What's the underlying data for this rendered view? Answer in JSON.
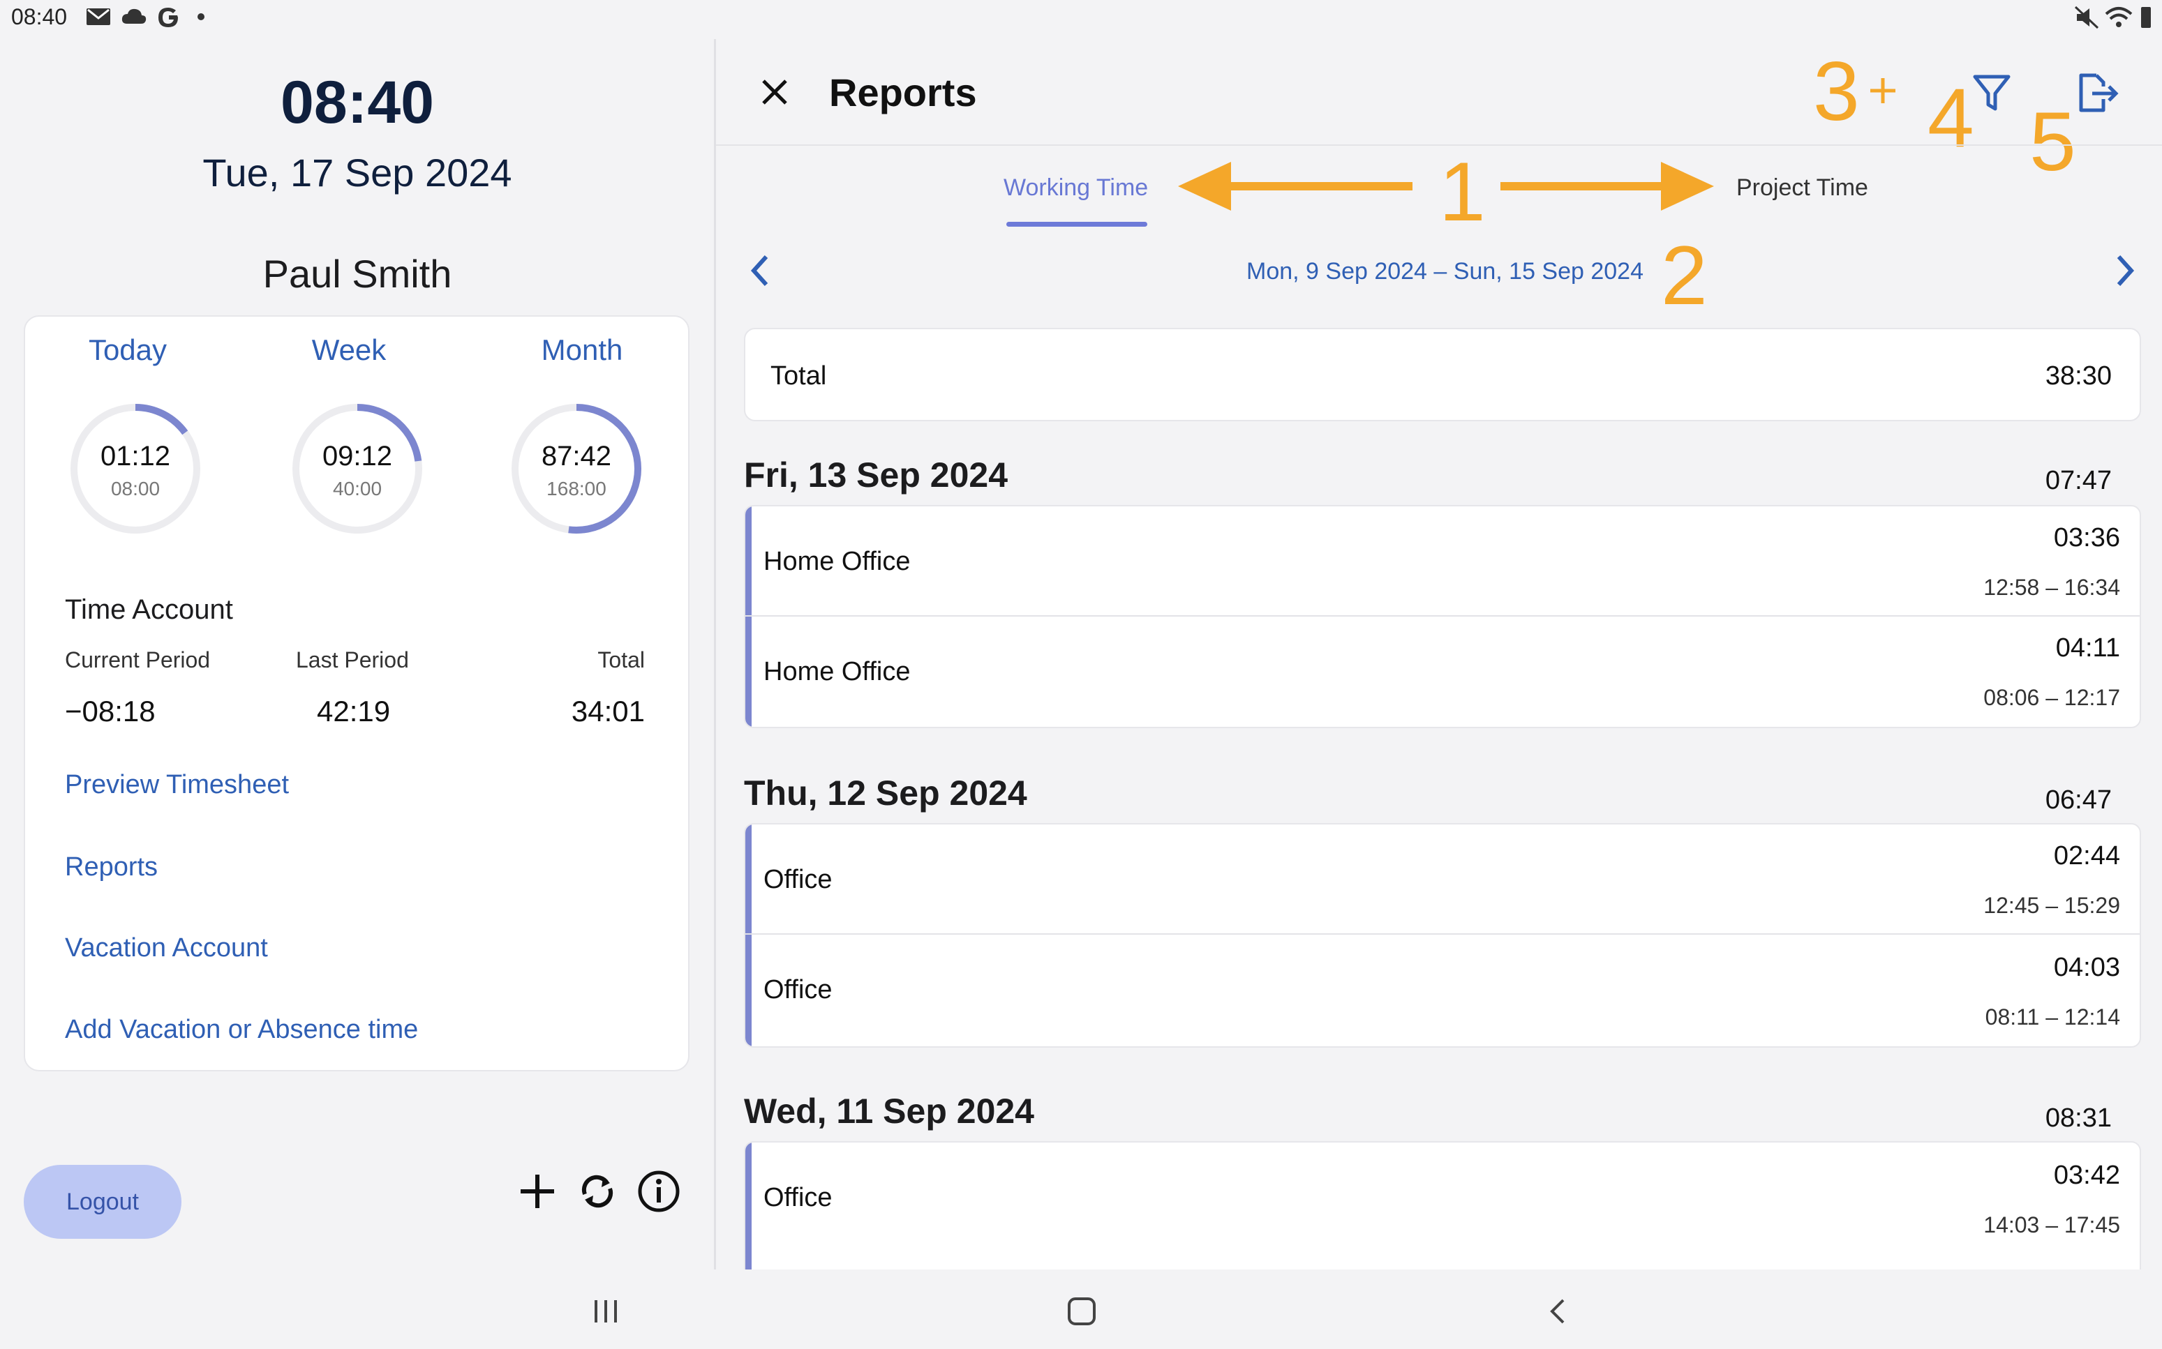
{
  "status_bar": {
    "time": "08:40"
  },
  "left": {
    "clock_time": "08:40",
    "clock_date": "Tue, 17 Sep 2024",
    "user_name": "Paul Smith",
    "periods": [
      {
        "label": "Today",
        "value": "01:12",
        "target": "08:00",
        "progress": 0.15
      },
      {
        "label": "Week",
        "value": "09:12",
        "target": "40:00",
        "progress": 0.23
      },
      {
        "label": "Month",
        "value": "87:42",
        "target": "168:00",
        "progress": 0.52
      }
    ],
    "time_account": {
      "title": "Time Account",
      "current_label": "Current Period",
      "last_label": "Last Period",
      "total_label": "Total",
      "current_value": "−08:18",
      "last_value": "42:19",
      "total_value": "34:01"
    },
    "links": {
      "preview": "Preview Timesheet",
      "reports": "Reports",
      "vacation": "Vacation Account",
      "add_vacation": "Add Vacation or Absence time"
    },
    "logout_label": "Logout"
  },
  "right": {
    "title": "Reports",
    "tabs": {
      "working": "Working Time",
      "project": "Project Time"
    },
    "date_range": "Mon, 9 Sep 2024 – Sun, 15 Sep 2024",
    "total_label": "Total",
    "total_value": "38:30",
    "days": [
      {
        "date": "Fri, 13 Sep 2024",
        "total": "07:47",
        "entries": [
          {
            "name": "Home Office",
            "duration": "03:36",
            "range": "12:58 – 16:34"
          },
          {
            "name": "Home Office",
            "duration": "04:11",
            "range": "08:06 – 12:17"
          }
        ]
      },
      {
        "date": "Thu, 12 Sep 2024",
        "total": "06:47",
        "entries": [
          {
            "name": "Office",
            "duration": "02:44",
            "range": "12:45 – 15:29"
          },
          {
            "name": "Office",
            "duration": "04:03",
            "range": "08:11 – 12:14"
          }
        ]
      },
      {
        "date": "Wed, 11 Sep 2024",
        "total": "08:31",
        "entries": [
          {
            "name": "Office",
            "duration": "03:42",
            "range": "14:03 – 17:45"
          }
        ]
      }
    ]
  },
  "annotations": {
    "n1": "1",
    "n2": "2",
    "n3": "3",
    "n4": "4",
    "n5": "5"
  },
  "colors": {
    "accent": "#2f5fb4",
    "tab_active": "#6878d4",
    "annotation": "#f4a72a",
    "entry_bar": "#7c86cf"
  }
}
